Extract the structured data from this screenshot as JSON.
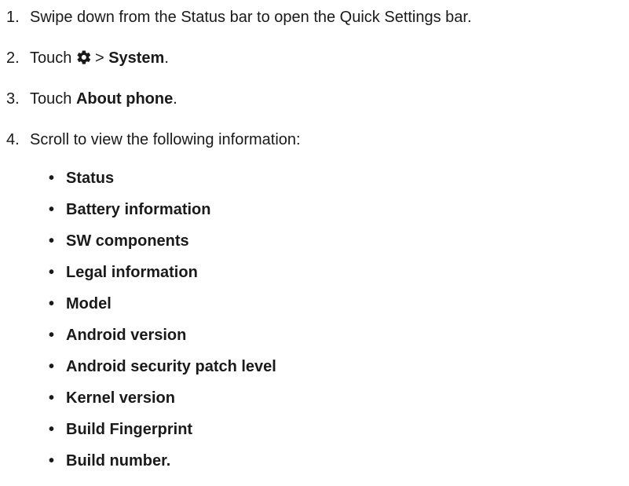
{
  "steps": [
    {
      "num": "1.",
      "text": "Swipe down from the Status bar to open the Quick Settings bar."
    },
    {
      "num": "2.",
      "prefix": "Touch",
      "icon": "gear-icon",
      "separator": ">",
      "target": "System",
      "suffix": "."
    },
    {
      "num": "3.",
      "prefix": "Touch",
      "target": "About phone",
      "suffix": "."
    },
    {
      "num": "4.",
      "text": "Scroll to view the following information:"
    }
  ],
  "bullet_char": "•",
  "info_items": [
    "Status",
    "Battery information",
    "SW components",
    "Legal information",
    "Model",
    "Android version",
    "Android security patch level",
    "Kernel version",
    "Build Fingerprint",
    "Build number."
  ]
}
